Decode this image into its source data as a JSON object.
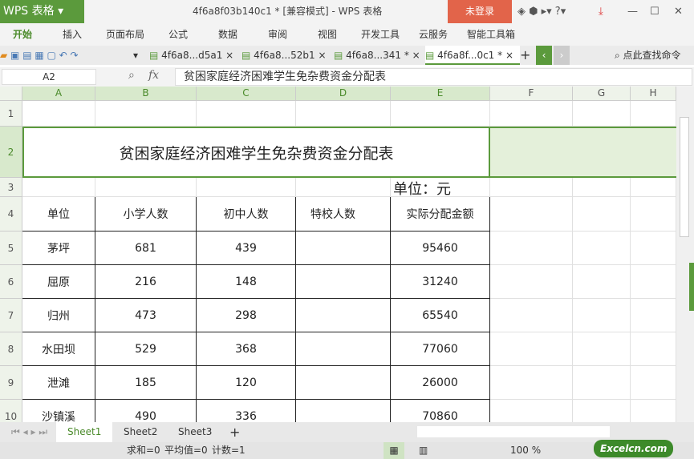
{
  "app": {
    "logo": "WPS 表格",
    "title": "4f6a8f03b140c1 * [兼容模式] - WPS 表格",
    "login": "未登录"
  },
  "menu": [
    "开始",
    "插入",
    "页面布局",
    "公式",
    "数据",
    "审阅",
    "视图",
    "开发工具",
    "云服务",
    "智能工具箱"
  ],
  "doc_tabs": [
    "4f6a8...d5a1",
    "4f6a8...52b1",
    "4f6a8...341 *",
    "4f6a8f...0c1 *"
  ],
  "search_label": "点此查找命令",
  "formula": {
    "cell_ref": "A2",
    "fx": "fx",
    "value": "贫困家庭经济困难学生免杂费资金分配表"
  },
  "columns": [
    "A",
    "B",
    "C",
    "D",
    "E",
    "F",
    "G",
    "H"
  ],
  "rows": [
    "1",
    "2",
    "3",
    "4",
    "5",
    "6",
    "7",
    "8",
    "9",
    "10"
  ],
  "sheet": {
    "title": "贫困家庭经济困难学生免杂费资金分配表",
    "unit": "单位：元",
    "headers": [
      "单位",
      "小学人数",
      "初中人数",
      "特校人数",
      "实际分配金额"
    ],
    "data": [
      [
        "茅坪",
        "681",
        "439",
        "",
        "95460"
      ],
      [
        "屈原",
        "216",
        "148",
        "",
        "31240"
      ],
      [
        "归州",
        "473",
        "298",
        "",
        "65540"
      ],
      [
        "水田坝",
        "529",
        "368",
        "",
        "77060"
      ],
      [
        "泄滩",
        "185",
        "120",
        "",
        "26000"
      ],
      [
        "沙镇溪",
        "490",
        "336",
        "",
        "70860"
      ]
    ]
  },
  "sheet_tabs": [
    "Sheet1",
    "Sheet2",
    "Sheet3"
  ],
  "status": {
    "sum": "求和=0",
    "avg": "平均值=0",
    "count": "计数=1",
    "zoom": "100 %"
  },
  "watermark": "Excelcn.com",
  "colors": {
    "accent": "#5b9a3c",
    "login": "#e2644a"
  }
}
